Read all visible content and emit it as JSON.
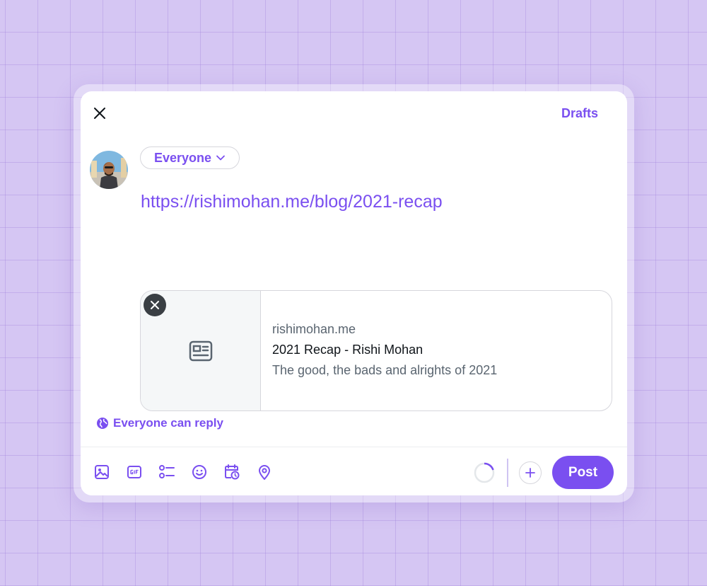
{
  "header": {
    "drafts_label": "Drafts"
  },
  "composer": {
    "audience_label": "Everyone",
    "text": "https://rishimohan.me/blog/2021-recap"
  },
  "link_card": {
    "domain": "rishimohan.me",
    "title": "2021 Recap - Rishi Mohan",
    "description": "The good, the bads and alrights of 2021"
  },
  "reply_setting": {
    "label": "Everyone can reply"
  },
  "toolbar": {
    "icons": [
      "image-icon",
      "gif-icon",
      "poll-icon",
      "emoji-icon",
      "schedule-icon",
      "location-icon"
    ],
    "post_label": "Post"
  },
  "colors": {
    "accent": "#7a4ff0",
    "background": "#d5c6f3"
  }
}
